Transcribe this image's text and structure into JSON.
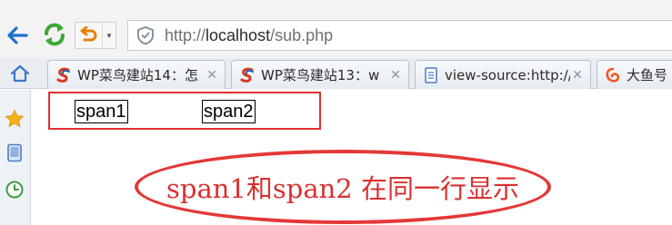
{
  "toolbar": {
    "back_icon": "back-arrow-icon",
    "refresh_icon": "refresh-icon",
    "undo_icon": "undo-icon"
  },
  "address_bar": {
    "url_scheme": "http://",
    "url_host": "localhost",
    "url_path": "/sub.php",
    "security_icon": "shield-icon"
  },
  "tabs": [
    {
      "title": "WP菜鸟建站14：怎",
      "icon": "site-logo-icon"
    },
    {
      "title": "WP菜鸟建站13：w",
      "icon": "site-logo-icon"
    },
    {
      "title": "view-source:http://",
      "icon": "document-icon"
    },
    {
      "title": "大鱼号",
      "icon": "dayu-logo-icon"
    }
  ],
  "sidebar": {
    "items": [
      "favorites-star-icon",
      "device-icon",
      "history-clock-icon"
    ]
  },
  "page": {
    "span1": "span1",
    "span2": "span2",
    "annotation": "span1和span2 在同一行显示"
  },
  "colors": {
    "annotation_red": "#e03030",
    "refresh_green": "#3aa935",
    "undo_orange": "#e8800c",
    "back_blue": "#1e6fd0"
  }
}
